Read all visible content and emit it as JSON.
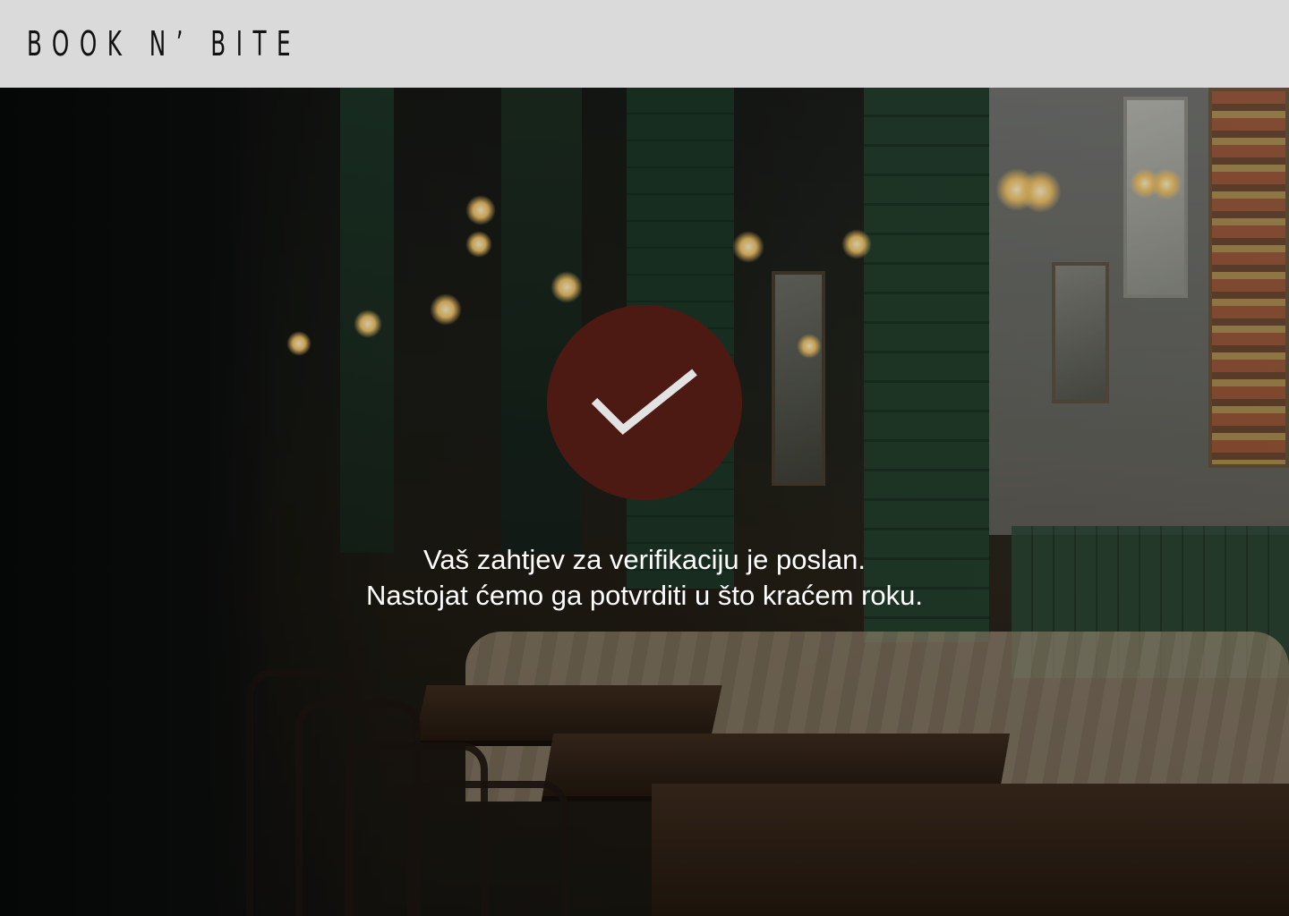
{
  "header": {
    "brand": "BOOK N’ BITE"
  },
  "confirmation": {
    "icon": "checkmark-icon",
    "line1": "Vaš zahtjev za verifikaciju je poslan.",
    "line2": "Nastojat ćemo ga potvrditi u što kraćem roku."
  },
  "colors": {
    "header_bg": "#dadada",
    "badge_bg": "#4c1a12",
    "check_stroke": "#e2e2e2",
    "text": "#ffffff"
  }
}
